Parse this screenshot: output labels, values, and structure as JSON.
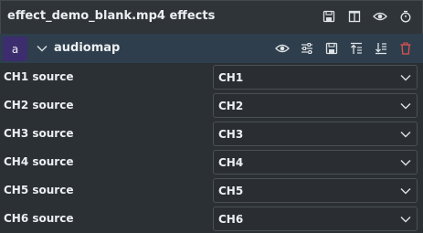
{
  "window": {
    "title": "effect_demo_blank.mp4 effects",
    "icons": [
      "save-icon",
      "columns-icon",
      "eye-icon",
      "timer-icon"
    ]
  },
  "effect": {
    "badge": "a",
    "name": "audiomap",
    "tools": [
      "eye-icon",
      "sliders-icon",
      "save-icon",
      "move-up-icon",
      "move-down-icon",
      "delete-icon"
    ],
    "delete_color": "#e05252"
  },
  "rows": [
    {
      "label": "CH1 source",
      "value": "CH1"
    },
    {
      "label": "CH2 source",
      "value": "CH2"
    },
    {
      "label": "CH3 source",
      "value": "CH3"
    },
    {
      "label": "CH4 source",
      "value": "CH4"
    },
    {
      "label": "CH5 source",
      "value": "CH5"
    },
    {
      "label": "CH6 source",
      "value": "CH6"
    }
  ]
}
